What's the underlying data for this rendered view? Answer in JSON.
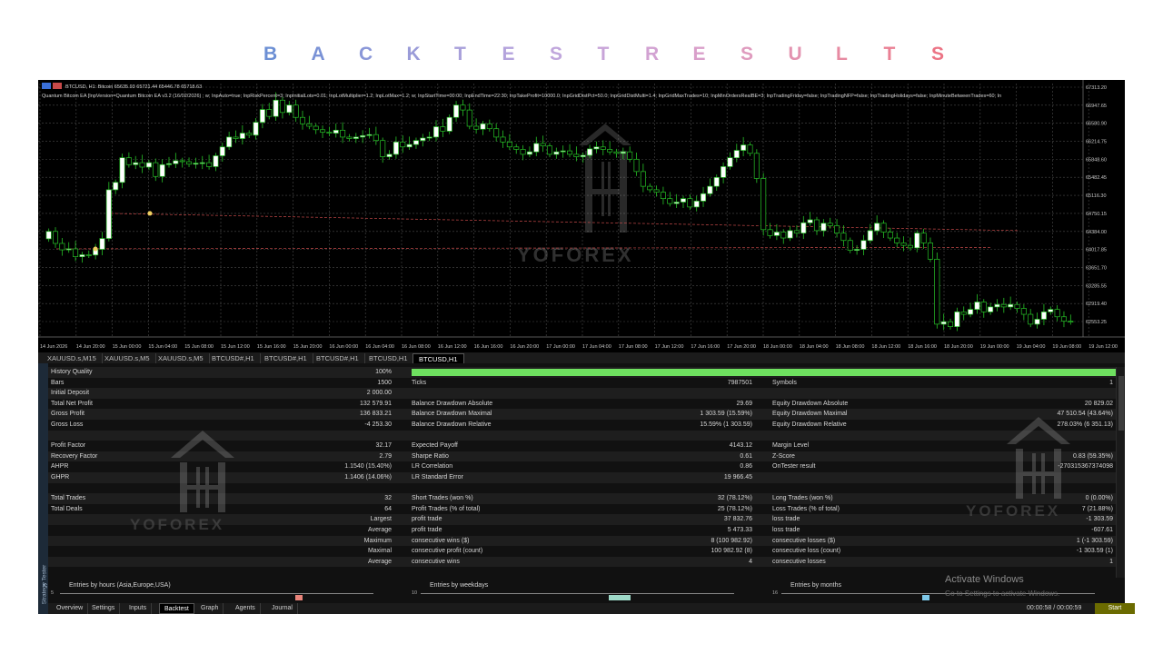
{
  "page": {
    "title_letters": [
      "B",
      "A",
      "C",
      "K",
      "T",
      "E",
      "S",
      "T",
      "R",
      "E",
      "S",
      "U",
      "L",
      "T",
      "S"
    ],
    "title_colors": [
      "#6c8fd4",
      "#7a92d6",
      "#8a97d8",
      "#9a9bd8",
      "#a8a0da",
      "#b4a3dc",
      "#c0a6dc",
      "#c8a4d8",
      "#d2a2d2",
      "#d99fca",
      "#df9bbe",
      "#e393b0",
      "#e78aa2",
      "#ea8094",
      "#ec7485"
    ]
  },
  "chart": {
    "symbol_info": "BTCUSD, H1: Bitcoin  65635.93 65721.44 65446.78 65718.63",
    "ea_info": "Quantum Bitcoin EA [InpVersion=Quantum Bitcoin EA v3.2 (16/02/2026) ; w; InpAuto=true; InpRiskPercent=3; InpInitialLots=0.01; InpLotMultiplier=1.2; InpLotMax=1.2; w; InpStartTime=00:00; InpEndTime=22:30; InpTakeProfit=10000.0; InpGridDistPct=50.0; InpGridDistMulti=1.4; InpGridMaxTrades=10; InpMinOrdersRealBE=3; InpTradingFriday=false; InpTradingNFP=false; InpTradingHolidays=false; InpMinuteBetweenTrades=60; In",
    "price_labels": [
      "67313.20",
      "66947.65",
      "66580.90",
      "66214.75",
      "65848.60",
      "65482.45",
      "65116.30",
      "64750.15",
      "64384.00",
      "64017.85",
      "63651.70",
      "63285.55",
      "62919.40",
      "62553.25"
    ],
    "time_labels": [
      "14 Jun 2026",
      "14 Jun 20:00",
      "15 Jun 00:00",
      "15 Jun 04:00",
      "15 Jun 08:00",
      "15 Jun 12:00",
      "15 Jun 16:00",
      "15 Jun 20:00",
      "16 Jun 00:00",
      "16 Jun 04:00",
      "16 Jun 08:00",
      "16 Jun 12:00",
      "16 Jun 16:00",
      "16 Jun 20:00",
      "17 Jun 00:00",
      "17 Jun 04:00",
      "17 Jun 08:00",
      "17 Jun 12:00",
      "17 Jun 16:00",
      "17 Jun 20:00",
      "18 Jun 00:00",
      "18 Jun 04:00",
      "18 Jun 08:00",
      "18 Jun 12:00",
      "18 Jun 16:00",
      "18 Jun 20:00",
      "19 Jun 00:00",
      "19 Jun 04:00",
      "19 Jun 08:00",
      "19 Jun 12:00"
    ],
    "watermark": "YOFOREX",
    "colors": {
      "bull": "#ffffff",
      "bear": "#000000",
      "wick": "#27c227",
      "grid": "#4a4a4a",
      "trade_line": "#c84a4a"
    },
    "closes": [
      64384,
      64140,
      64010,
      64030,
      63870,
      63910,
      63905,
      64020,
      64240,
      65230,
      65380,
      65880,
      65740,
      65780,
      65690,
      65780,
      65500,
      65740,
      65760,
      65820,
      65800,
      65750,
      65770,
      65780,
      65700,
      65920,
      66100,
      66300,
      66270,
      66380,
      66340,
      66600,
      66860,
      66720,
      67050,
      66800,
      66950,
      66700,
      66570,
      66520,
      66450,
      66400,
      66380,
      66440,
      66300,
      66270,
      66300,
      66330,
      66350,
      66230,
      65900,
      65950,
      66200,
      66100,
      66150,
      66230,
      66280,
      66300,
      66510,
      66420,
      66700,
      66950,
      66850,
      66520,
      66460,
      66570,
      66470,
      66300,
      66200,
      66100,
      66050,
      65950,
      66000,
      66170,
      66120,
      65950,
      66000,
      66020,
      65950,
      65900,
      65930,
      66060,
      66100,
      66050,
      66000,
      65970,
      66000,
      65850,
      65600,
      65300,
      65230,
      65180,
      65050,
      64950,
      64980,
      65050,
      64880,
      65000,
      65150,
      65300,
      65480,
      65700,
      65880,
      66030,
      66140,
      65970,
      65460,
      64420,
      64300,
      64370,
      64250,
      64400,
      64350,
      64560,
      64620,
      64400,
      64550,
      64500,
      64350,
      64200,
      64000,
      64020,
      64200,
      64400,
      64550,
      64370,
      64250,
      64150,
      64100,
      64050,
      64350,
      64150,
      63820,
      62500,
      62550,
      62450,
      62750,
      62700,
      62800,
      62950,
      62750,
      62850,
      62900,
      62850,
      62900,
      62820,
      62700,
      62500,
      62600,
      62750,
      62800,
      62650,
      62560,
      62550
    ]
  },
  "chart_tabs": [
    "XAUUSD.s,M15",
    "XAUUSD.s,M5",
    "XAUUSD.s,M5",
    "BTCUSD#,H1",
    "BTCUSD#,H1",
    "BTCUSD#,H1",
    "BTCUSD,H1",
    "BTCUSD,H1"
  ],
  "results": {
    "history_quality": {
      "label": "History Quality",
      "value": "100%"
    },
    "rows": [
      {
        "c1": {
          "label": "Bars",
          "value": "1500"
        },
        "c2": {
          "label": "Ticks",
          "value": "7987501"
        },
        "c3": {
          "label": "Symbols",
          "value": "1"
        }
      },
      {
        "c1": {
          "label": "Initial Deposit",
          "value": "2 000.00"
        }
      },
      {
        "c1": {
          "label": "Total Net Profit",
          "value": "132 579.91"
        },
        "c2": {
          "label": "Balance Drawdown Absolute",
          "value": "29.69"
        },
        "c3": {
          "label": "Equity Drawdown Absolute",
          "value": "20 829.02"
        }
      },
      {
        "c1": {
          "label": "Gross Profit",
          "value": "136 833.21"
        },
        "c2": {
          "label": "Balance Drawdown Maximal",
          "value": "1 303.59 (15.59%)"
        },
        "c3": {
          "label": "Equity Drawdown Maximal",
          "value": "47 510.54 (43.64%)"
        }
      },
      {
        "c1": {
          "label": "Gross Loss",
          "value": "-4 253.30"
        },
        "c2": {
          "label": "Balance Drawdown Relative",
          "value": "15.59% (1 303.59)"
        },
        "c3": {
          "label": "Equity Drawdown Relative",
          "value": "278.03% (6 351.13)"
        }
      },
      {},
      {
        "c1": {
          "label": "Profit Factor",
          "value": "32.17"
        },
        "c2": {
          "label": "Expected Payoff",
          "value": "4143.12"
        },
        "c3": {
          "label": "Margin Level",
          "value": ""
        }
      },
      {
        "c1": {
          "label": "Recovery Factor",
          "value": "2.79"
        },
        "c2": {
          "label": "Sharpe Ratio",
          "value": "0.61"
        },
        "c3": {
          "label": "Z-Score",
          "value": "0.83 (59.35%)"
        }
      },
      {
        "c1": {
          "label": "AHPR",
          "value": "1.1540 (15.40%)"
        },
        "c2": {
          "label": "LR Correlation",
          "value": "0.86"
        },
        "c3": {
          "label": "OnTester result",
          "value": "-270315367374098"
        }
      },
      {
        "c1": {
          "label": "GHPR",
          "value": "1.1406 (14.06%)"
        },
        "c2": {
          "label": "LR Standard Error",
          "value": "19 966.45"
        }
      },
      {},
      {
        "c1": {
          "label": "Total Trades",
          "value": "32"
        },
        "c2": {
          "label": "Short Trades (won %)",
          "value": "32 (78.12%)"
        },
        "c3": {
          "label": "Long Trades (won %)",
          "value": "0 (0.00%)"
        }
      },
      {
        "c1": {
          "label": "Total Deals",
          "value": "64"
        },
        "c2": {
          "label": "Profit Trades (% of total)",
          "value": "25 (78.12%)"
        },
        "c3": {
          "label": "Loss Trades (% of total)",
          "value": "7 (21.88%)"
        }
      },
      {
        "c1": {
          "label": "",
          "value": "Largest"
        },
        "c2": {
          "label": "profit trade",
          "value": "37 832.76"
        },
        "c3": {
          "label": "loss trade",
          "value": "-1 303.59"
        }
      },
      {
        "c1": {
          "label": "",
          "value": "Average"
        },
        "c2": {
          "label": "profit trade",
          "value": "5 473.33"
        },
        "c3": {
          "label": "loss trade",
          "value": "-607.61"
        }
      },
      {
        "c1": {
          "label": "",
          "value": "Maximum"
        },
        "c2": {
          "label": "consecutive wins ($)",
          "value": "8 (100 982.92)"
        },
        "c3": {
          "label": "consecutive losses ($)",
          "value": "1 (-1 303.59)"
        }
      },
      {
        "c1": {
          "label": "",
          "value": "Maximal"
        },
        "c2": {
          "label": "consecutive profit (count)",
          "value": "100 982.92 (8)"
        },
        "c3": {
          "label": "consecutive loss (count)",
          "value": "-1 303.59 (1)"
        }
      },
      {
        "c1": {
          "label": "",
          "value": "Average"
        },
        "c2": {
          "label": "consecutive wins",
          "value": "4"
        },
        "c3": {
          "label": "consecutive losses",
          "value": "1"
        }
      }
    ]
  },
  "histograms": [
    {
      "title": "Entries by hours (Asia,Europe,USA)",
      "scale": "5",
      "bar_pos": 0.75,
      "bar_color": "#e8847a"
    },
    {
      "title": "Entries by weekdays",
      "scale": "10",
      "bar_pos": 0.6,
      "bar_color": "#9ed9c8"
    },
    {
      "title": "Entries by months",
      "scale": "16",
      "bar_pos": 0.45,
      "bar_color": "#7ec8e8"
    }
  ],
  "bottom_tabs": [
    "Overview",
    "Settings",
    "Inputs",
    "Backtest",
    "Graph",
    "Agents",
    "Journal"
  ],
  "side_label": "Strategy Tester",
  "activate": {
    "title": "Activate Windows",
    "subtitle": "Go to Settings to activate Windows."
  },
  "timer": "00:00:58 / 00:00:59",
  "start_label": "Start",
  "watermark": "YOFOREX"
}
